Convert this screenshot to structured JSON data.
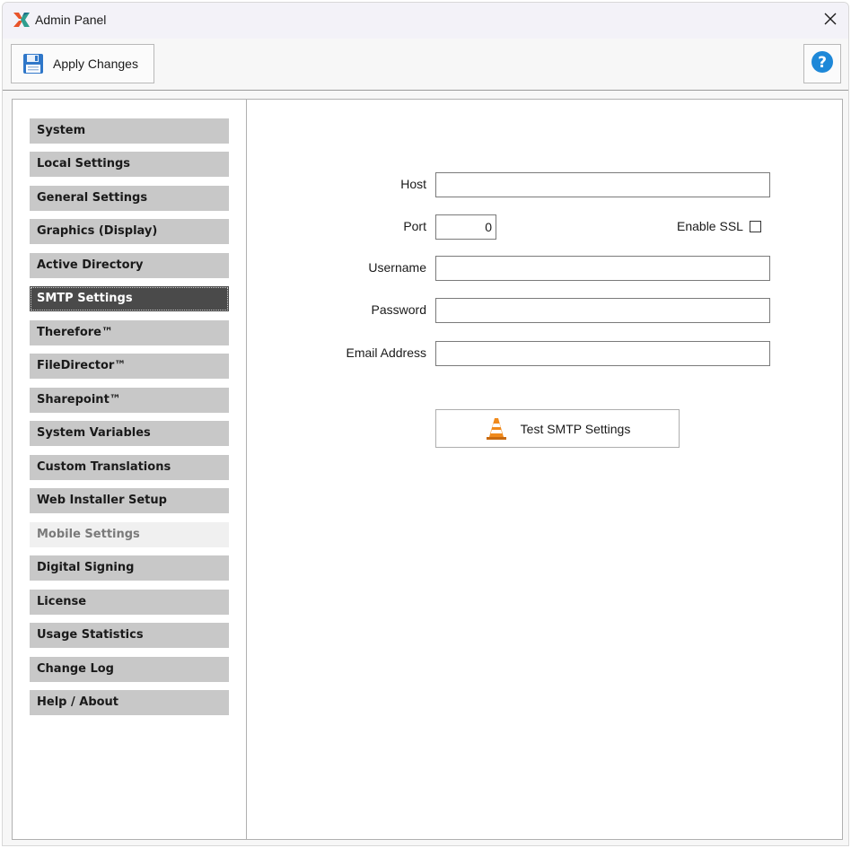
{
  "window": {
    "title": "Admin Panel"
  },
  "toolbar": {
    "apply_label": "Apply Changes",
    "help_label": "?"
  },
  "sidebar": {
    "items": [
      {
        "label": "System",
        "state": "normal"
      },
      {
        "label": "Local Settings",
        "state": "normal"
      },
      {
        "label": "General Settings",
        "state": "normal"
      },
      {
        "label": "Graphics (Display)",
        "state": "normal"
      },
      {
        "label": "Active Directory",
        "state": "normal"
      },
      {
        "label": "SMTP Settings",
        "state": "active"
      },
      {
        "label": "Therefore™",
        "state": "normal"
      },
      {
        "label": "FileDirector™",
        "state": "normal"
      },
      {
        "label": "Sharepoint™",
        "state": "normal"
      },
      {
        "label": "System Variables",
        "state": "normal"
      },
      {
        "label": "Custom Translations",
        "state": "normal"
      },
      {
        "label": "Web Installer Setup",
        "state": "normal"
      },
      {
        "label": "Mobile Settings",
        "state": "disabled"
      },
      {
        "label": "Digital Signing",
        "state": "normal"
      },
      {
        "label": "License",
        "state": "normal"
      },
      {
        "label": "Usage Statistics",
        "state": "normal"
      },
      {
        "label": "Change Log",
        "state": "normal"
      },
      {
        "label": "Help / About",
        "state": "normal"
      }
    ]
  },
  "smtp": {
    "host_label": "Host",
    "host_value": "",
    "port_label": "Port",
    "port_value": "0",
    "ssl_label": "Enable SSL",
    "ssl_checked": false,
    "username_label": "Username",
    "username_value": "",
    "password_label": "Password",
    "password_value": "",
    "email_label": "Email Address",
    "email_value": "",
    "test_label": "Test SMTP Settings"
  },
  "colors": {
    "nav_normal": "#c8c8c8",
    "nav_active": "#4a4a4a",
    "nav_disabled": "#f0f0f0",
    "help_blue": "#1e88d8",
    "cone_orange": "#f08a1c",
    "save_blue": "#2f77c9"
  }
}
